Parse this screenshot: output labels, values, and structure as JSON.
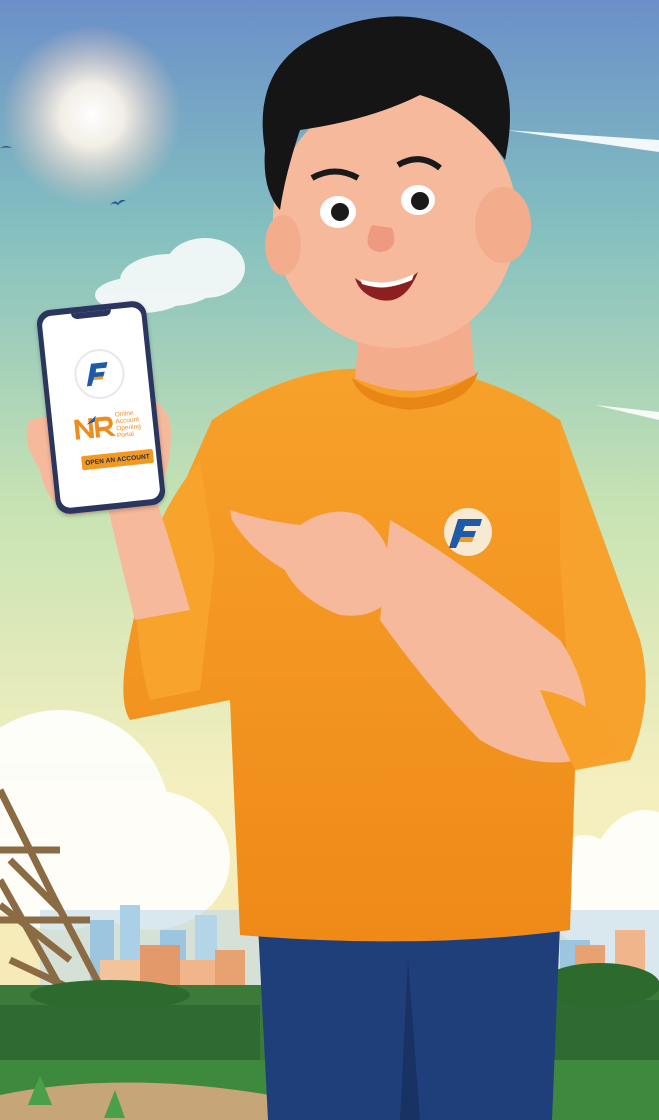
{
  "phone_screen": {
    "app_logo_letter": "F",
    "portal_badge": "NR",
    "portal_text": [
      "Online",
      "Account",
      "Opening",
      "Portal"
    ],
    "cta_label": "OPEN AN ACCOUNT"
  },
  "shirt_logo_letter": "F",
  "colors": {
    "sky_top": "#4f86c6",
    "sky_mid": "#7cc7b6",
    "sky_bottom": "#f4ecb8",
    "shirt": "#f6951f",
    "jeans": "#1f3f7a",
    "skin": "#f6b99b",
    "hair": "#151515",
    "logo_blue": "#1d5aa8",
    "logo_orange": "#f39a1d"
  },
  "icons": [
    "f-logo-icon",
    "nr-portal-icon",
    "bird-icon",
    "sun-icon"
  ]
}
